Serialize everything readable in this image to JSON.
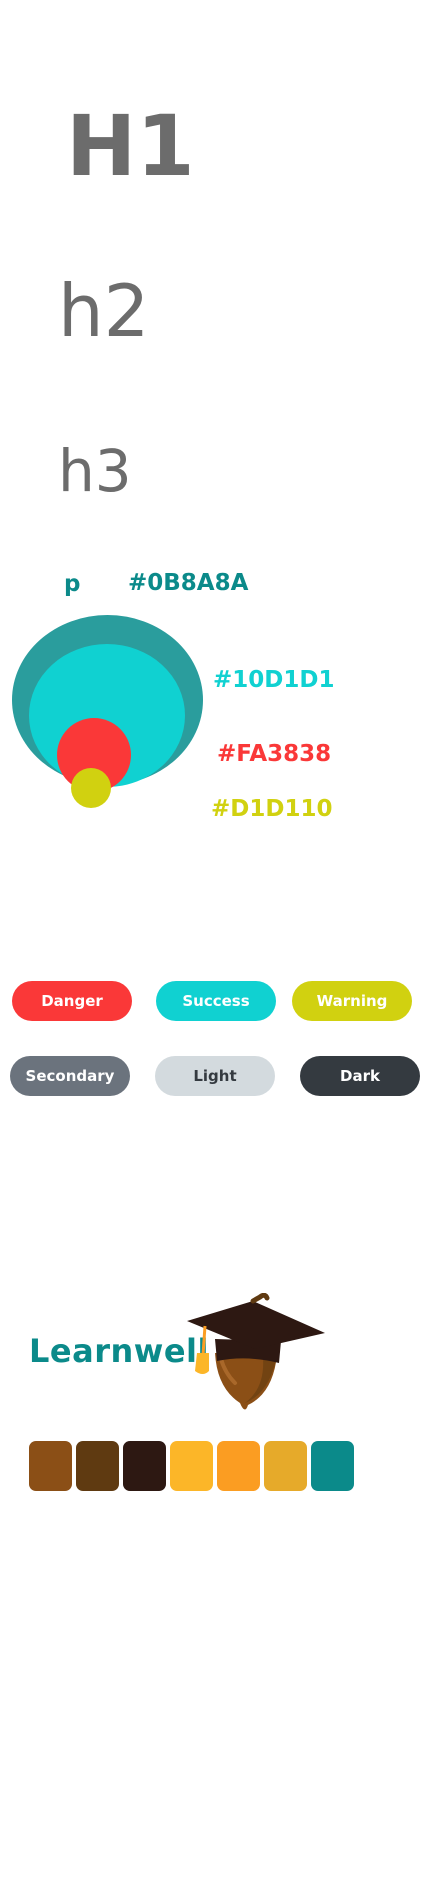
{
  "headings": {
    "h1": "H1",
    "h2": "h2",
    "h3": "h3"
  },
  "typography": {
    "p_label": "p"
  },
  "swatches": {
    "teal": {
      "label": "#0B8A8A",
      "color": "#0b8a8a"
    },
    "cyan": {
      "label": "#10D1D1",
      "color": "#10d1d1"
    },
    "red": {
      "label": "#FA3838",
      "color": "#fa3838"
    },
    "yellow": {
      "label": "#D1D110",
      "color": "#d1d110"
    }
  },
  "buttons": {
    "danger": "Danger",
    "success": "Success",
    "warning": "Warning",
    "secondary": "Secondary",
    "light": "Light",
    "dark": "Dark"
  },
  "brand": {
    "name": "Learnwell",
    "logo_icon": "graduation-cap-acorn-icon",
    "palette": [
      "#8b4f16",
      "#5f3a11",
      "#2d1812",
      "#fcb628",
      "#fb9d22",
      "#e6aa2a",
      "#0b8a8a"
    ]
  }
}
